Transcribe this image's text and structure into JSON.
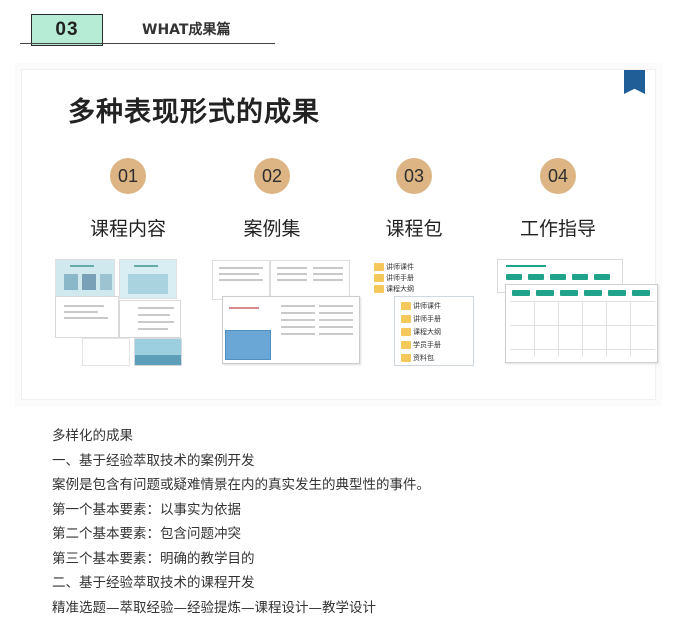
{
  "header": {
    "number": "03",
    "title": "WHAT成果篇"
  },
  "slide": {
    "title": "多种表现形式的成果",
    "items": [
      {
        "number": "01",
        "label": "课程内容"
      },
      {
        "number": "02",
        "label": "案例集"
      },
      {
        "number": "03",
        "label": "课程包"
      },
      {
        "number": "04",
        "label": "工作指导"
      }
    ],
    "package_tree_top": [
      "讲师课件",
      "讲师手册",
      "课程大纲"
    ],
    "package_tree_bottom": [
      "讲师课件",
      "讲师手册",
      "课程大纲",
      "学员手册",
      "资料包"
    ]
  },
  "body": {
    "lines": [
      "多样化的成果",
      "一、基于经验萃取技术的案例开发",
      "案例是包含有问题或疑难情景在内的真实发生的典型性的事件。",
      "第一个基本要素：以事实为依据",
      "第二个基本要素：包含问题冲突",
      "第三个基本要素：明确的教学目的",
      "二、基于经验萃取技术的课程开发",
      "精准选题—萃取经验—经验提炼—课程设计—教学设计"
    ]
  },
  "colors": {
    "header_badge": "#b6ecd6",
    "number_circle": "#ddb584",
    "bookmark": "#1f5e96",
    "folder": "#f4c85a"
  }
}
